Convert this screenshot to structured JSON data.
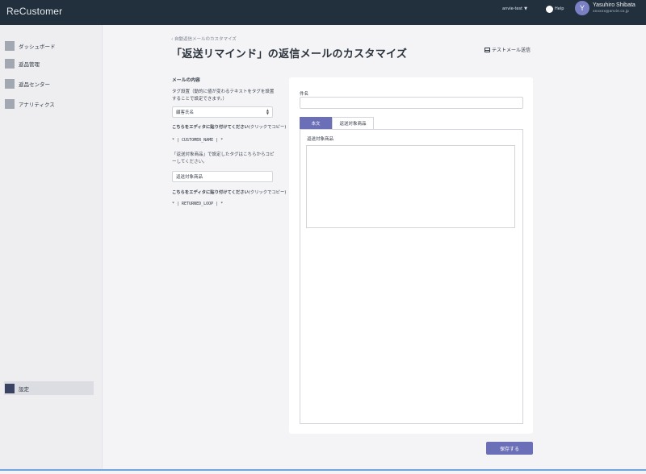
{
  "header": {
    "brand": "ReCustomer",
    "account": "anvie-test",
    "help_label": "Help",
    "avatar_initial": "Y",
    "user_name": "Yasuhiro Shibata",
    "user_email": "xxxxxx@anvie.co.jp"
  },
  "sidebar": {
    "items": [
      {
        "label": "ダッシュボード",
        "icon": "dashboard-icon"
      },
      {
        "label": "返品管理",
        "icon": "returns-icon"
      },
      {
        "label": "返品センター",
        "icon": "return-center-icon"
      },
      {
        "label": "アナリティクス",
        "icon": "analytics-icon"
      }
    ],
    "settings_label": "設定"
  },
  "breadcrumb": "自動返信メールのカスタマイズ",
  "page_title": "「返送リマインド」の返信メールのカスタマイズ",
  "test_mail_label": "テストメール送信",
  "left": {
    "section_title": "メールの内容",
    "help_text_1": "タグ設置（動的に値が変わるテキストをタグを設置することで設定できます。）",
    "select_value": "顧客氏名",
    "paste_note_1_main": "こちらをエディタに貼り付けてください",
    "paste_note_1_sub": "(クリックでコピー)",
    "tag_1": "* | CUSTOMER_NAME | *",
    "help_text_2": "「返送対象商品」で設定したタグはこちらからコピーしてください。",
    "input_value": "返送対象商品",
    "paste_note_2_main": "こちらをエディタに貼り付けてください",
    "paste_note_2_sub": "(クリックでコピー)",
    "tag_2": "* | RETURNED_LOOP | *"
  },
  "editor": {
    "subject_label": "件名",
    "tabs": [
      "本文",
      "返送対象商品"
    ],
    "panel_label": "返送対象商品"
  },
  "save_label": "保存する",
  "colors": {
    "header_bg": "#22303e",
    "accent": "#6b6fb8",
    "sidebar_bg": "#eeeef1"
  }
}
